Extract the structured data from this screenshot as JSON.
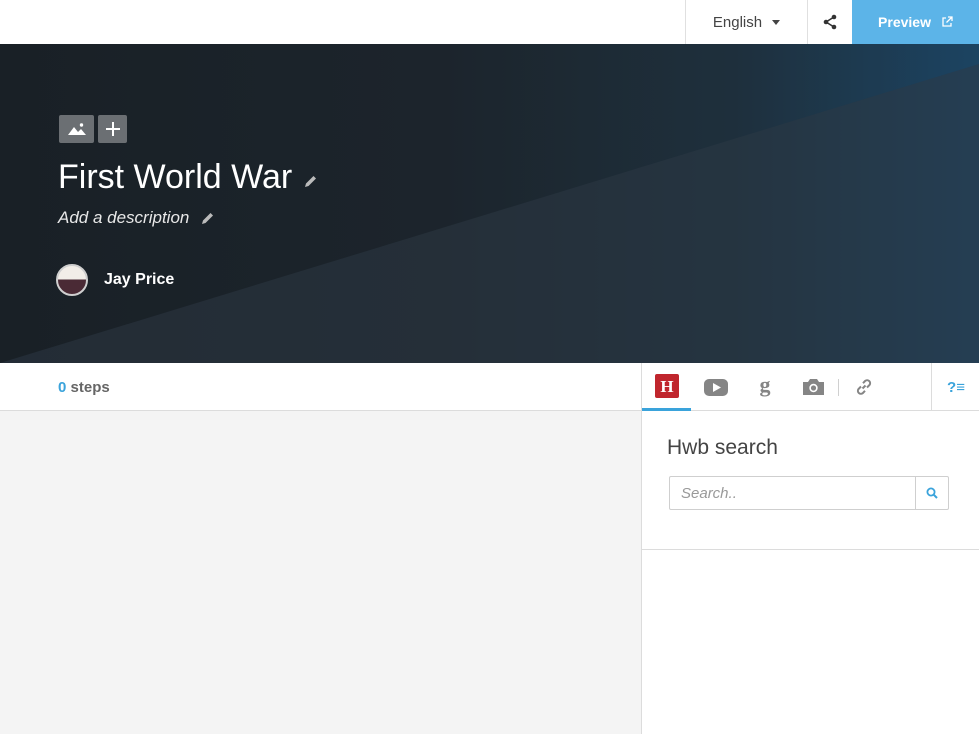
{
  "topbar": {
    "language": "English",
    "share_icon": "share-icon",
    "preview_label": "Preview",
    "preview_icon": "external-link-icon",
    "accent_color": "#5cb4e8"
  },
  "hero": {
    "media_buttons": [
      "image-icon",
      "plus-icon"
    ],
    "title": "First World War",
    "description_placeholder": "Add a description",
    "author_name": "Jay Price"
  },
  "steps": {
    "count": "0",
    "label": "steps"
  },
  "panel": {
    "tabs": [
      {
        "icon": "hwb-icon",
        "label": "H",
        "active": true
      },
      {
        "icon": "youtube-icon"
      },
      {
        "icon": "google-icon",
        "label": "g"
      },
      {
        "icon": "camera-icon"
      },
      {
        "icon": "link-icon"
      }
    ],
    "help_label": "?≡",
    "search_title": "Hwb search",
    "search_placeholder": "Search..",
    "search_icon": "search-icon"
  }
}
